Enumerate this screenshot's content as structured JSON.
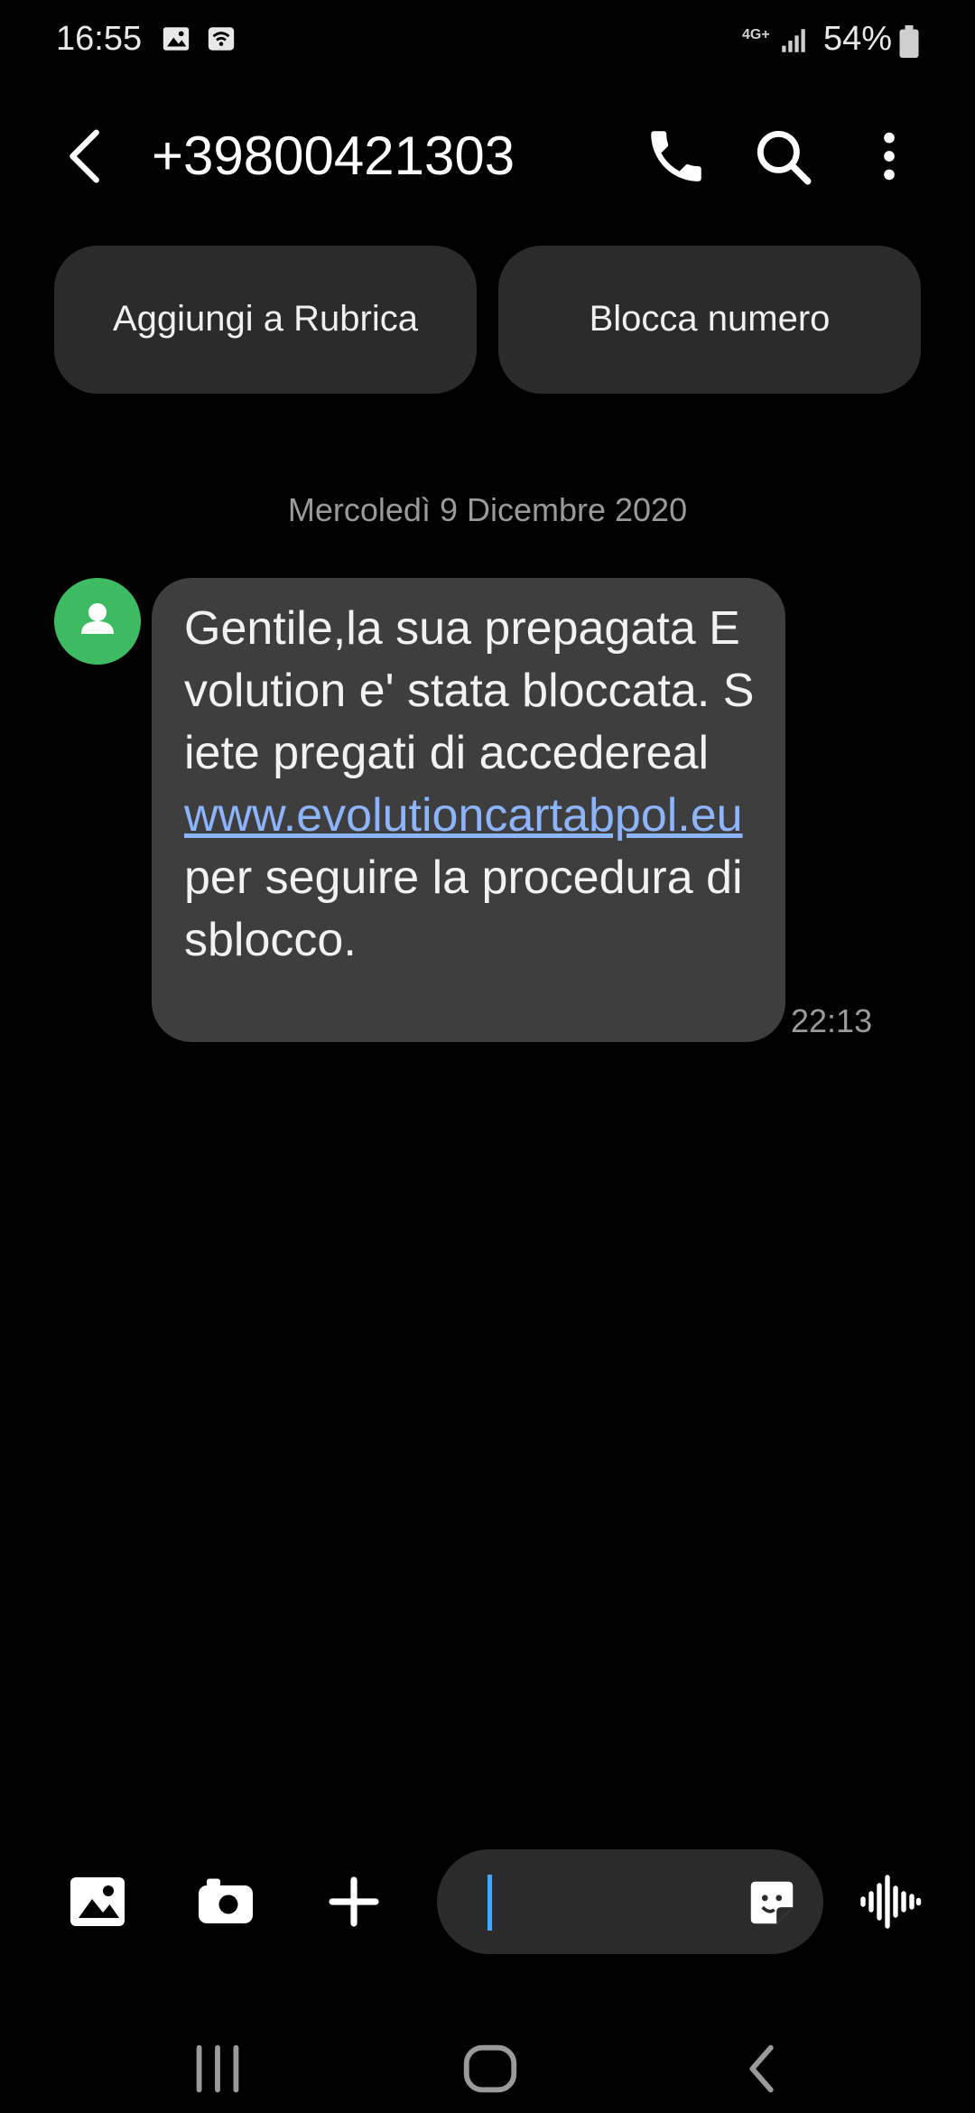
{
  "status_bar": {
    "time": "16:55",
    "network": "4G+",
    "battery": "54%"
  },
  "header": {
    "contact": "+39800421303",
    "icons": [
      "back-icon",
      "phone-icon",
      "search-icon",
      "more-vert-icon"
    ]
  },
  "actions": {
    "add_contact": "Aggiungi a Rubrica",
    "block_number": "Blocca numero"
  },
  "conversation": {
    "date": "Mercoledì 9 Dicembre 2020",
    "message": {
      "text_before": "Gentile,la sua prepagata Evolution e' stata bloccata. Siete pregati di accedereal ",
      "link": "www.evolutioncartabpol.eu",
      "text_after": " per seguire la procedura di sblocco.",
      "time": "22:13"
    }
  },
  "composer": {
    "placeholder": "",
    "icons": [
      "image-icon",
      "camera-icon",
      "plus-icon",
      "sticker-icon",
      "voice-icon"
    ]
  },
  "colors": {
    "background": "#000000",
    "bubble": "#3e3e3e",
    "link": "#8db4ff",
    "avatar": "#3dbb63",
    "cursor": "#4aa3ff"
  }
}
